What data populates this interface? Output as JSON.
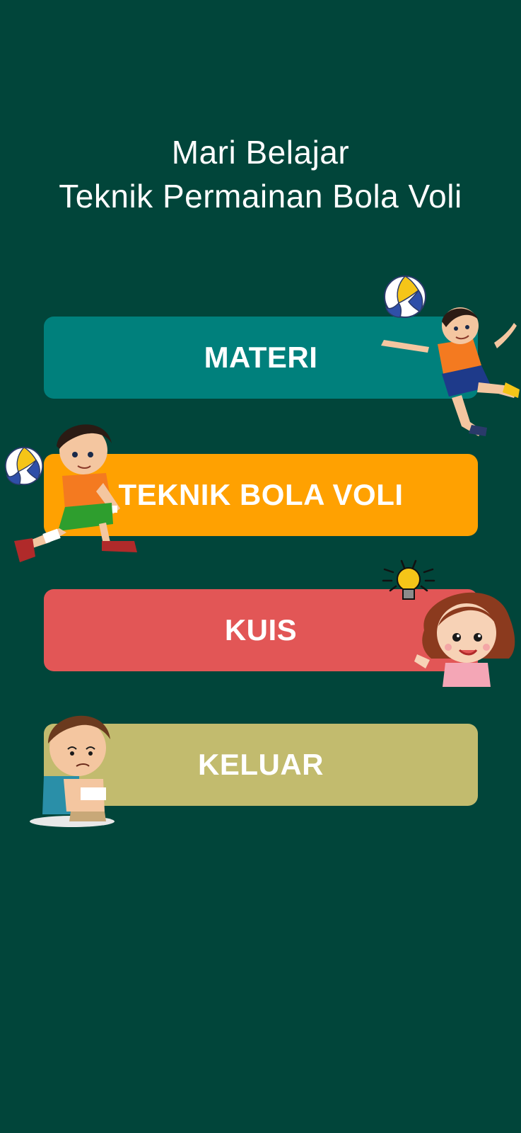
{
  "header": {
    "title_line1": "Mari Belajar",
    "title_line2": "Teknik Permainan Bola Voli"
  },
  "menu": {
    "materi": "MATERI",
    "teknik": "TEKNIK BOLA VOLI",
    "kuis": "KUIS",
    "keluar": "KELUAR"
  },
  "colors": {
    "background": "#01453A",
    "materi": "#00807C",
    "teknik": "#FFA101",
    "kuis": "#E25656",
    "keluar": "#C2BB6E"
  },
  "icons": {
    "ball": "volleyball-icon",
    "spiker": "boy-spiking-illustration",
    "receiver": "boy-receiving-illustration",
    "girl": "girl-idea-illustration",
    "sad": "sad-boy-illustration"
  }
}
